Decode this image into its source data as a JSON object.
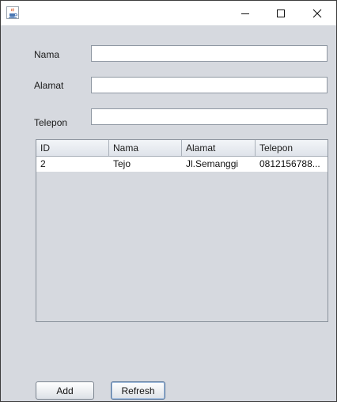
{
  "window": {
    "icon": "java-cup-icon",
    "controls": {
      "minimize": "minimize-icon",
      "maximize": "maximize-icon",
      "close": "close-icon"
    }
  },
  "form": {
    "nama_label": "Nama",
    "nama_value": "",
    "alamat_label": "Alamat",
    "alamat_value": "",
    "telepon_label": "Telepon",
    "telepon_value": ""
  },
  "table": {
    "columns": [
      "ID",
      "Nama",
      "Alamat",
      "Telepon"
    ],
    "rows": [
      [
        "2",
        "Tejo",
        "Jl.Semanggi",
        "0812156788..."
      ]
    ]
  },
  "buttons": {
    "add": "Add",
    "refresh": "Refresh"
  }
}
